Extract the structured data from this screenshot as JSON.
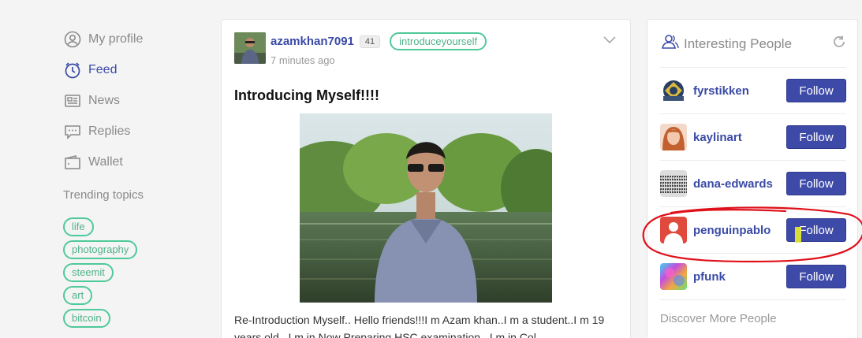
{
  "nav": {
    "items": [
      {
        "label": "My profile",
        "icon": "user-circle-icon",
        "active": false
      },
      {
        "label": "Feed",
        "icon": "clock-icon",
        "active": true
      },
      {
        "label": "News",
        "icon": "newspaper-icon",
        "active": false
      },
      {
        "label": "Replies",
        "icon": "chat-bubble-icon",
        "active": false
      },
      {
        "label": "Wallet",
        "icon": "wallet-icon",
        "active": false
      }
    ],
    "trending_title": "Trending topics",
    "tags": [
      "life",
      "photography",
      "steemit",
      "art",
      "bitcoin"
    ]
  },
  "post": {
    "author": "azamkhan7091",
    "reputation": "41",
    "tag": "introduceyourself",
    "time": "7 minutes ago",
    "title": "Introducing Myself!!!!",
    "body": "Re-Introduction Myself.. Hello friends!!!I m Azam khan..I m a student..I m 19 years old...I m in Now Preparing HSC examination...I m in Col..."
  },
  "side": {
    "title": "Interesting People",
    "people": [
      {
        "name": "fyrstikken",
        "follow_label": "Follow"
      },
      {
        "name": "kaylinart",
        "follow_label": "Follow"
      },
      {
        "name": "dana-edwards",
        "follow_label": "Follow"
      },
      {
        "name": "penguinpablo",
        "follow_label": "Follow"
      },
      {
        "name": "pfunk",
        "follow_label": "Follow"
      }
    ],
    "discover": "Discover More People"
  },
  "colors": {
    "accent": "#3e4aa8",
    "tag_green": "#4fc99a",
    "annotation_red": "#e0101a"
  }
}
